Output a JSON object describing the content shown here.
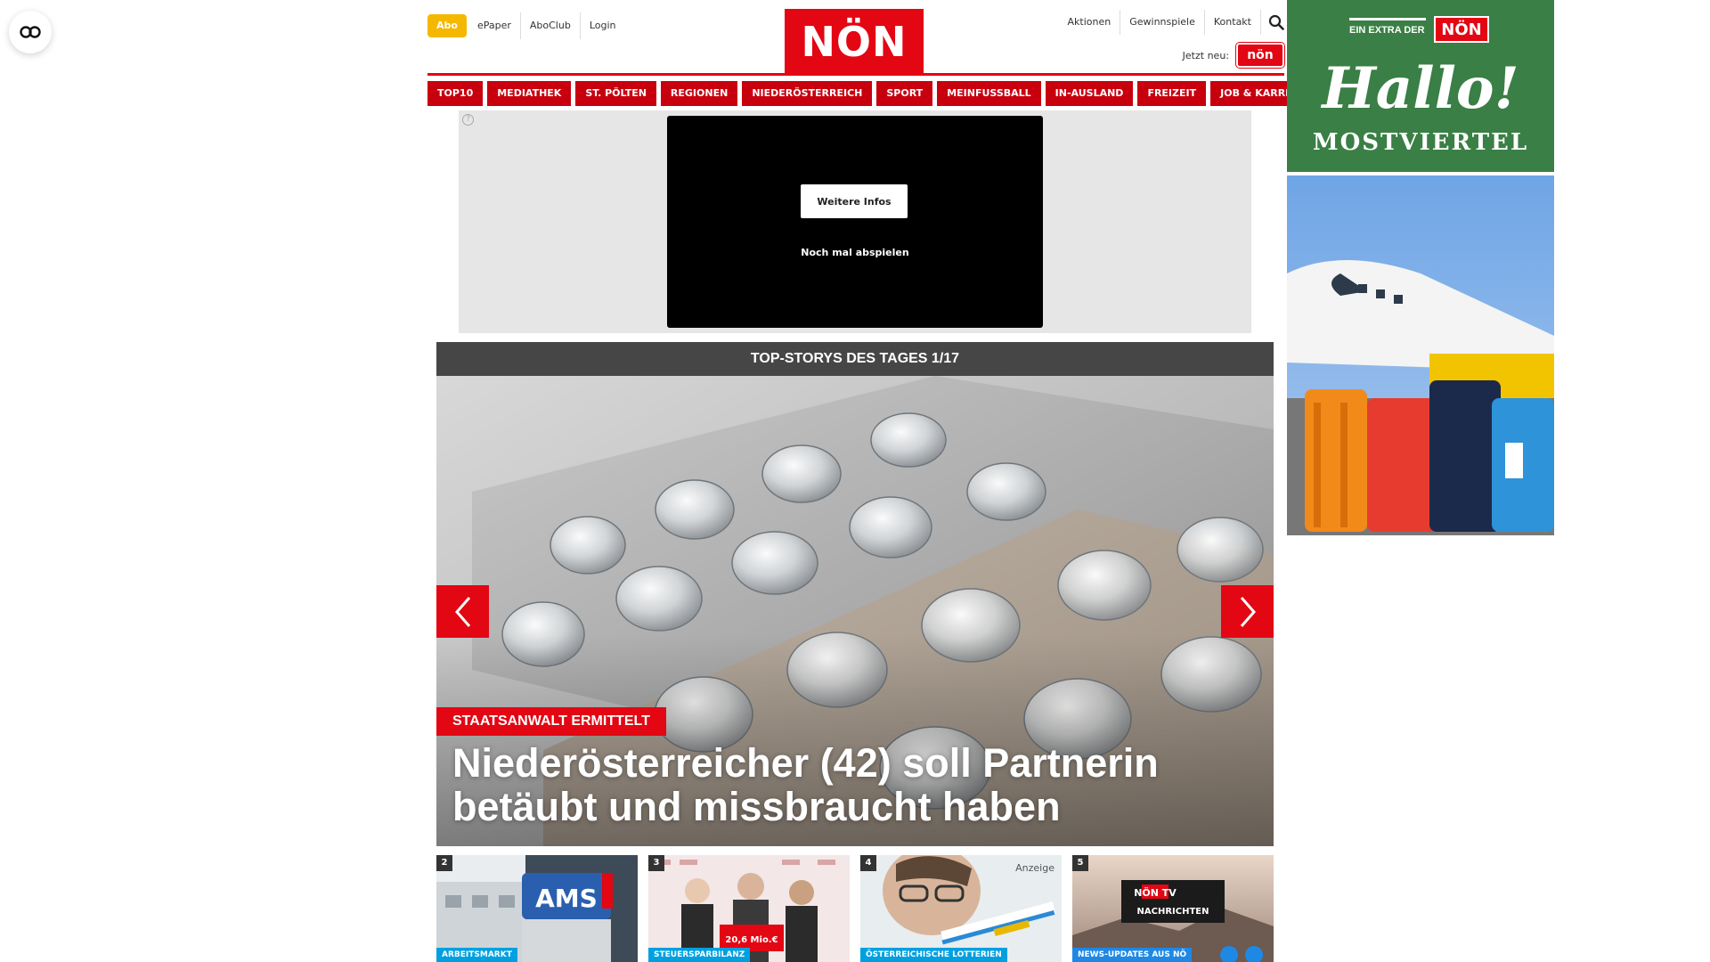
{
  "header": {
    "abo_label": "Abo",
    "top_links": [
      "ePaper",
      "AboClub",
      "Login"
    ],
    "logo_text": "NÖN",
    "right_links": [
      "Aktionen",
      "Gewinnspiele",
      "Kontakt"
    ],
    "jetzt_neu_label": "Jetzt neu:",
    "jetzt_logo_text": "nön"
  },
  "nav": {
    "items": [
      "TOP10",
      "MEDIATHEK",
      "ST. PÖLTEN",
      "REGIONEN",
      "NIEDERÖSTERREICH",
      "SPORT",
      "MEINFUSSBALL",
      "IN-AUSLAND",
      "FREIZEIT",
      "JOB & KARRIERE"
    ]
  },
  "video_ad": {
    "info_icon": "?",
    "more_info_label": "Weitere Infos",
    "replay_label": "Noch mal abspielen"
  },
  "top_stories": {
    "bar_title": "TOP-STORYS DES TAGES 1/17",
    "kicker": "STAATSANWALT ERMITTELT",
    "headline": "Niederösterreicher (42) soll Partnerin betäubt und missbraucht haben"
  },
  "thumbnails": [
    {
      "number": "2",
      "tag": "ARBEITSMARKT",
      "sign_text": "AMS"
    },
    {
      "number": "3",
      "tag": "STEUERSPARBILANZ",
      "cheque_text": "20,6 Mio.€"
    },
    {
      "number": "4",
      "tag": "ÖSTERREICHISCHE LOTTERIEN",
      "anzeige": "Anzeige"
    },
    {
      "number": "5",
      "tag": "NEWS-UPDATES AUS NÖ",
      "tv_logo": "NÖN TV",
      "tv_label": "NACHRICHTEN"
    }
  ],
  "side_ad": {
    "extra_text": "EIN EXTRA DER",
    "extra_logo": "NÖN",
    "hallo": "Hallo!",
    "region": "MOSTVIERTEL"
  },
  "colors": {
    "brand_red": "#e30613",
    "nav_red": "#c8000e",
    "abo_yellow": "#f5b800",
    "stories_bar": "#464646",
    "side_ad_green": "#3a7f45"
  }
}
